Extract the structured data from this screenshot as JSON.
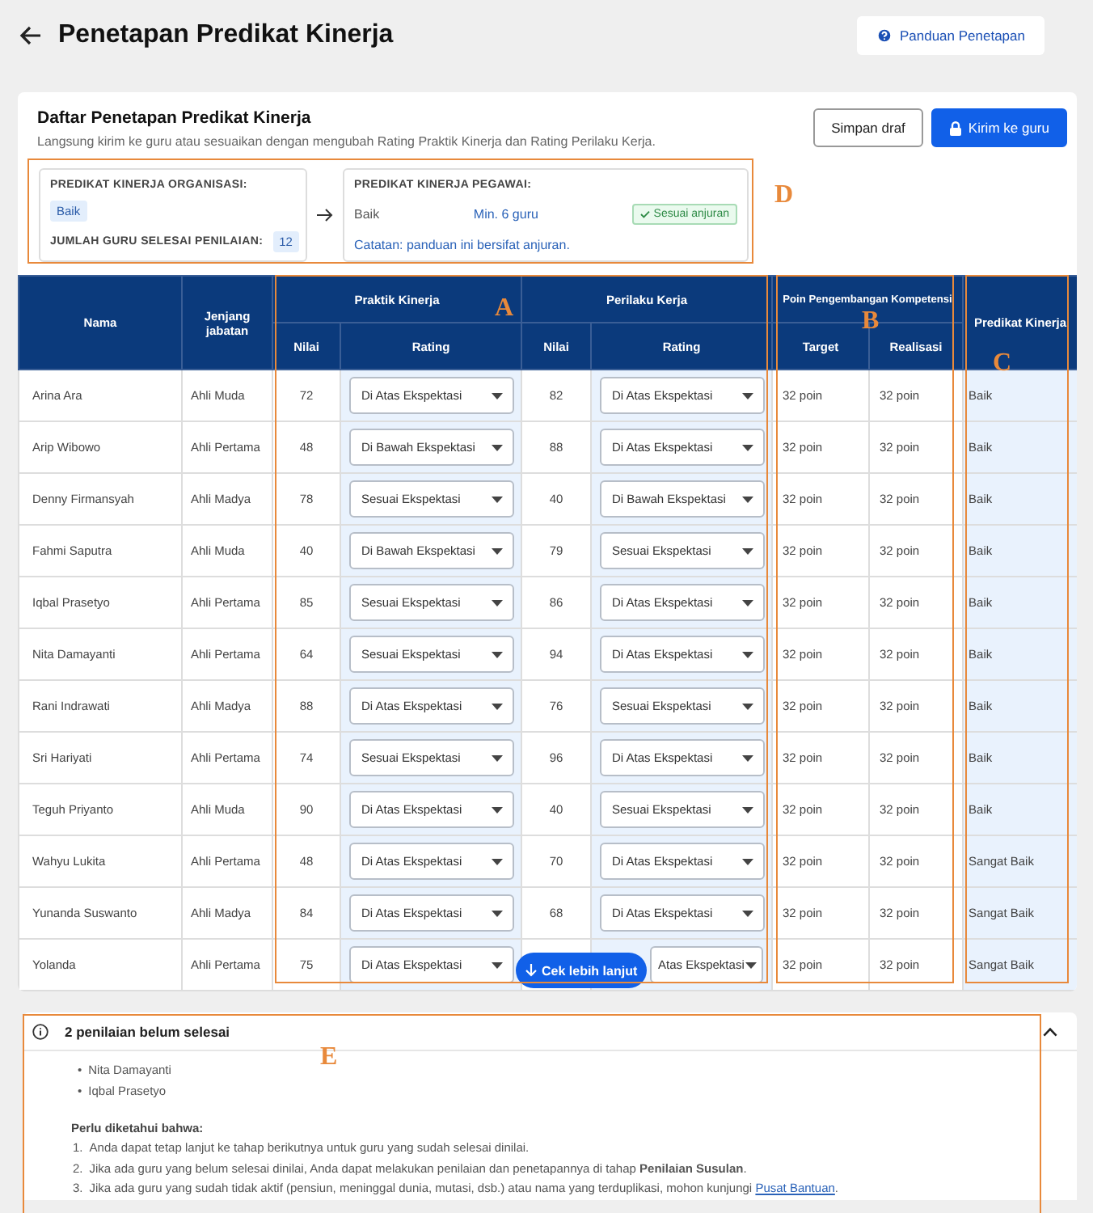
{
  "page": {
    "title": "Penetapan Predikat Kinerja",
    "guide_button": "Panduan Penetapan"
  },
  "card": {
    "title": "Daftar Penetapan Predikat Kinerja",
    "subtitle": "Langsung kirim ke guru atau sesuaikan dengan mengubah Rating Praktik Kinerja dan Rating Perilaku Kerja.",
    "buttons": [
      {
        "label": "Simpan draf",
        "kind": "secondary"
      },
      {
        "label": "Kirim ke guru",
        "kind": "primary"
      }
    ]
  },
  "summary": {
    "org_label": "PREDIKAT KINERJA ORGANISASI:",
    "org_value": "Baik",
    "count_label": "JUMLAH GURU SELESAI PENILAIAN:",
    "count_value": "12",
    "employee_label": "PREDIKAT KINERJA PEGAWAI:",
    "employee_value": "Baik",
    "min_text": "Min. 6 guru",
    "status": "Sesuai anjuran",
    "note": "Catatan: panduan ini bersifat anjuran."
  },
  "table": {
    "top_headers": [
      "Nama",
      "Jenjang jabatan",
      "Praktik Kinerja",
      "Perilaku Kerja",
      "Poin Pengembangan Kompetensi",
      "Predikat Kinerja"
    ],
    "sub_headers": [
      "Nilai",
      "Rating",
      "Nilai",
      "Rating",
      "Target",
      "Realisasi"
    ],
    "rows": [
      {
        "name": "Arina Ara",
        "level": "Ahli Muda",
        "practice_score": "72",
        "practice_rating": "Di Atas Ekspektasi",
        "behavior_score": "82",
        "behavior_rating": "Di Atas Ekspektasi",
        "target": "32 poin",
        "realization": "32 poin",
        "predicate": "Baik"
      },
      {
        "name": "Arip Wibowo",
        "level": "Ahli Pertama",
        "practice_score": "48",
        "practice_rating": "Di Bawah Ekspektasi",
        "behavior_score": "88",
        "behavior_rating": "Di Atas Ekspektasi",
        "target": "32 poin",
        "realization": "32 poin",
        "predicate": "Baik"
      },
      {
        "name": "Denny Firmansyah",
        "level": "Ahli Madya",
        "practice_score": "78",
        "practice_rating": "Sesuai Ekspektasi",
        "behavior_score": "40",
        "behavior_rating": "Di Bawah Ekspektasi",
        "target": "32 poin",
        "realization": "32 poin",
        "predicate": "Baik"
      },
      {
        "name": "Fahmi Saputra",
        "level": "Ahli Muda",
        "practice_score": "40",
        "practice_rating": "Di Bawah Ekspektasi",
        "behavior_score": "79",
        "behavior_rating": "Sesuai Ekspektasi",
        "target": "32 poin",
        "realization": "32 poin",
        "predicate": "Baik"
      },
      {
        "name": "Iqbal Prasetyo",
        "level": "Ahli Pertama",
        "practice_score": "85",
        "practice_rating": "Sesuai Ekspektasi",
        "behavior_score": "86",
        "behavior_rating": "Di Atas Ekspektasi",
        "target": "32 poin",
        "realization": "32 poin",
        "predicate": "Baik"
      },
      {
        "name": "Nita Damayanti",
        "level": "Ahli Pertama",
        "practice_score": "64",
        "practice_rating": "Sesuai Ekspektasi",
        "behavior_score": "94",
        "behavior_rating": "Di Atas Ekspektasi",
        "target": "32 poin",
        "realization": "32 poin",
        "predicate": "Baik"
      },
      {
        "name": "Rani Indrawati",
        "level": "Ahli Madya",
        "practice_score": "88",
        "practice_rating": "Di Atas Ekspektasi",
        "behavior_score": "76",
        "behavior_rating": "Sesuai Ekspektasi",
        "target": "32 poin",
        "realization": "32 poin",
        "predicate": "Baik"
      },
      {
        "name": "Sri Hariyati",
        "level": "Ahli Pertama",
        "practice_score": "74",
        "practice_rating": "Sesuai Ekspektasi",
        "behavior_score": "96",
        "behavior_rating": "Di Atas Ekspektasi",
        "target": "32 poin",
        "realization": "32 poin",
        "predicate": "Baik"
      },
      {
        "name": "Teguh Priyanto",
        "level": "Ahli Muda",
        "practice_score": "90",
        "practice_rating": "Di Atas Ekspektasi",
        "behavior_score": "40",
        "behavior_rating": "Sesuai Ekspektasi",
        "target": "32 poin",
        "realization": "32 poin",
        "predicate": "Baik"
      },
      {
        "name": "Wahyu Lukita",
        "level": "Ahli Pertama",
        "practice_score": "48",
        "practice_rating": "Di Atas Ekspektasi",
        "behavior_score": "70",
        "behavior_rating": "Di Atas Ekspektasi",
        "target": "32 poin",
        "realization": "32 poin",
        "predicate": "Sangat Baik"
      },
      {
        "name": "Yunanda Suswanto",
        "level": "Ahli Madya",
        "practice_score": "84",
        "practice_rating": "Di Atas Ekspektasi",
        "behavior_score": "68",
        "behavior_rating": "Di Atas Ekspektasi",
        "target": "32 poin",
        "realization": "32 poin",
        "predicate": "Sangat Baik"
      },
      {
        "name": "Yolanda",
        "level": "Ahli Pertama",
        "practice_score": "75",
        "practice_rating": "Di Atas Ekspektasi",
        "behavior_rating": "Atas Ekspektasi",
        "behavior_rating_covered": true,
        "target": "32 poin",
        "realization": "32 poin",
        "predicate": "Sangat Baik"
      }
    ]
  },
  "floating_button": "Cek lebih lanjut",
  "notice": {
    "title": "2 penilaian belum selesai",
    "expanded": true,
    "names": [
      {
        "marker": "•",
        "text": "Nita Damayanti"
      },
      {
        "marker": "•",
        "text": "Iqbal Prasetyo"
      }
    ],
    "info_title": "Perlu diketahui bahwa:",
    "items": [
      {
        "marker": "1.",
        "text": "Anda dapat tetap lanjut ke tahap berikutnya untuk guru yang sudah selesai dinilai."
      },
      {
        "marker": "2.",
        "text": "Jika ada guru yang belum selesai dinilai, Anda dapat melakukan penilaian dan penetapannya di tahap **Penilaian Susulan**."
      },
      {
        "marker": "3.",
        "text": "Jika ada guru yang sudah tidak aktif (pensiun, meninggal dunia, mutasi, dsb.) atau nama yang terduplikasi, mohon kunjungi",
        "link": "Pusat Bantuan",
        "after": "."
      }
    ]
  },
  "annotations": [
    {
      "label": "D"
    },
    {
      "label": "A"
    },
    {
      "label": "B"
    },
    {
      "label": "C"
    },
    {
      "label": "E"
    }
  ]
}
